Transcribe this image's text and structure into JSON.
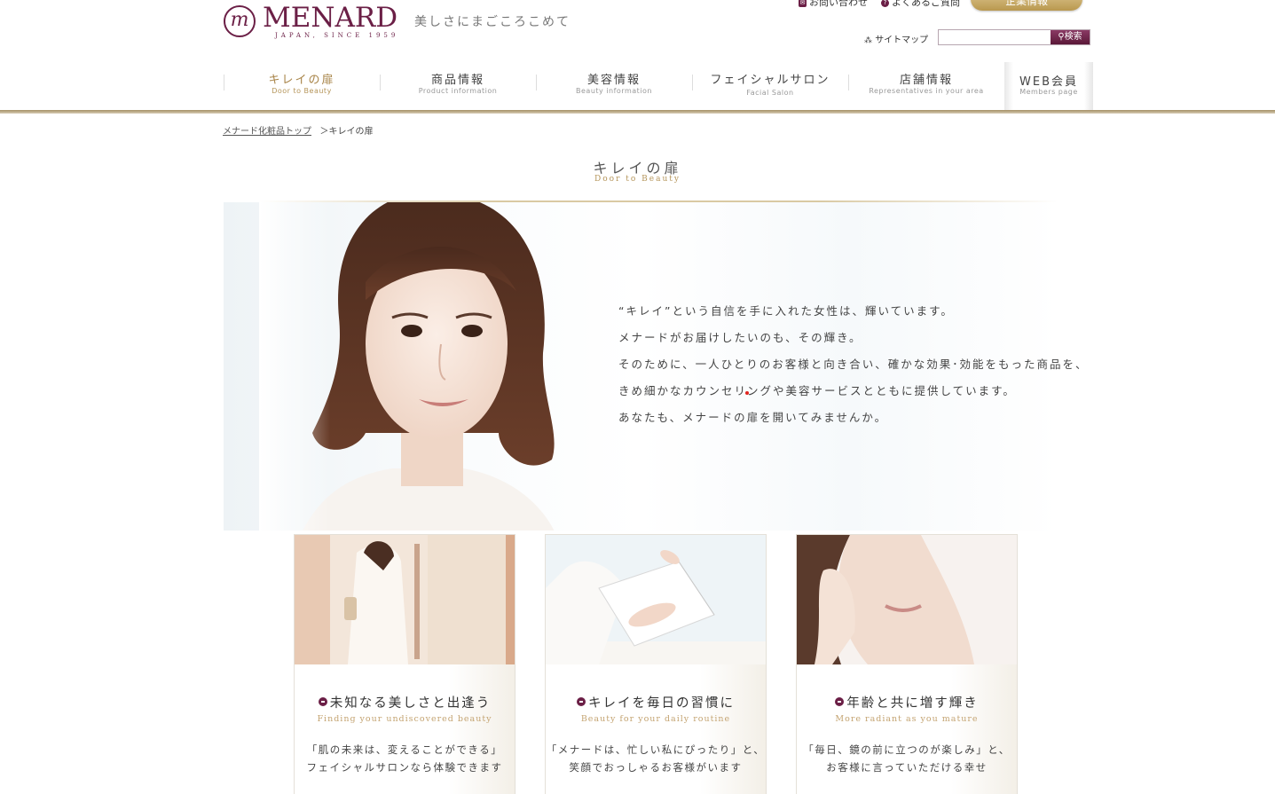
{
  "header": {
    "logo_name": "MENARD",
    "logo_sub": "JAPAN, SINCE 1959",
    "tagline": "美しさにまごころこめて",
    "util_links": [
      {
        "label": "お問い合わせ"
      },
      {
        "label": "よくあるご質問"
      }
    ],
    "corp_button": "企業情報",
    "sitemap": "サイトマップ",
    "search": {
      "placeholder": "",
      "button": "検索"
    }
  },
  "nav": [
    {
      "jp": "キレイの扉",
      "en": "Door to Beauty",
      "active": true
    },
    {
      "jp": "商品情報",
      "en": "Product information"
    },
    {
      "jp": "美容情報",
      "en": "Beauty information"
    },
    {
      "jp": "フェイシャルサロン",
      "en": "Facial Salon"
    },
    {
      "jp": "店舗情報",
      "en": "Representatives in your area"
    },
    {
      "jp": "WEB会員",
      "en": "Members page"
    }
  ],
  "breadcrumb": {
    "home": "メナード化粧品トップ",
    "sep": "＞",
    "current": "キレイの扉"
  },
  "page": {
    "title": "キレイの扉",
    "subtitle": "Door to Beauty"
  },
  "hero": {
    "lines": [
      "“キレイ”という自信を手に入れた女性は、輝いています。",
      "メナードがお届けしたいのも、その輝き。",
      "そのために、一人ひとりのお客様と向き合い、確かな効果･効能をもった商品を、",
      "きめ細かなカウンセリングや美容サービスとともに提供しています。",
      "あなたも、メナードの扉を開いてみませんか。"
    ]
  },
  "cards": [
    {
      "title": "未知なる美しさと出逢う",
      "sub": "Finding your undiscovered beauty",
      "desc": [
        "「肌の未来は、変えることができる」",
        "フェイシャルサロンなら体験できます"
      ]
    },
    {
      "title": "キレイを毎日の習慣に",
      "sub": "Beauty for your daily routine",
      "desc": [
        "「メナードは、忙しい私にぴったり」と、",
        "笑顔でおっしゃるお客様がいます"
      ]
    },
    {
      "title": "年齢と共に増す輝き",
      "sub": "More radiant as you mature",
      "desc": [
        "「毎日、鏡の前に立つのが楽しみ」と、",
        "お客様に言っていただける幸せ"
      ]
    }
  ]
}
